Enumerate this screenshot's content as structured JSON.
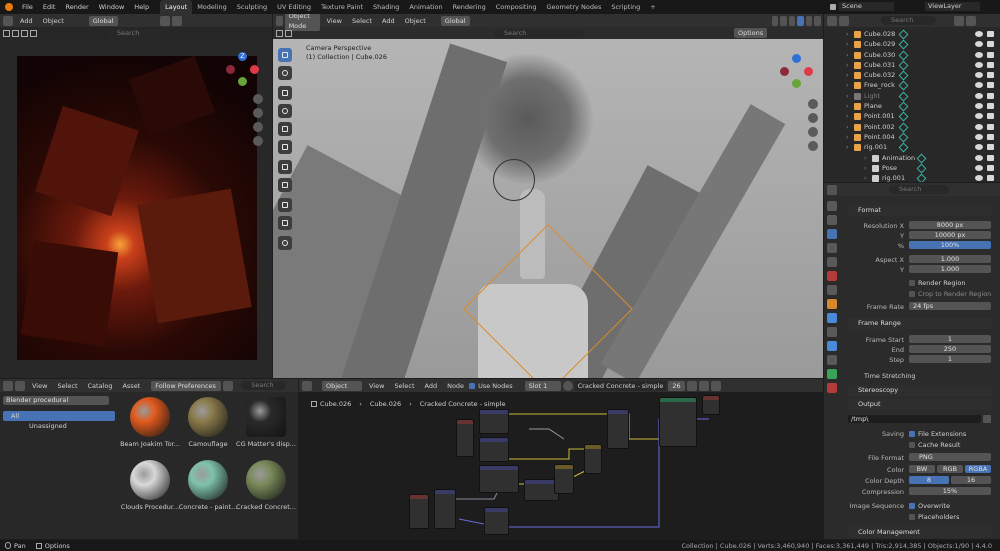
{
  "topbar": {
    "menus": [
      "File",
      "Edit",
      "Render",
      "Window",
      "Help"
    ],
    "workspaces": [
      "Layout",
      "Modeling",
      "Sculpting",
      "UV Editing",
      "Texture Paint",
      "Shading",
      "Animation",
      "Rendering",
      "Compositing",
      "Geometry Nodes",
      "Scripting"
    ],
    "active_workspace": "Layout",
    "add_tab": "+",
    "scene": "Scene",
    "view_layer": "ViewLayer"
  },
  "image_editor": {
    "menus": [
      "Add",
      "Object"
    ],
    "transform": "Global",
    "search_placeholder": "Search"
  },
  "viewport": {
    "mode": "Object Mode",
    "menus": [
      "View",
      "Select",
      "Add",
      "Object"
    ],
    "transform": "Global",
    "search_placeholder": "Search",
    "options": "Options",
    "camera_info": "Camera Perspective",
    "collection_info": "(1) Collection | Cube.026",
    "gizmo_axes": [
      "Z",
      "Y",
      "X"
    ]
  },
  "outliner": {
    "search_placeholder": "Search",
    "items": [
      {
        "label": "Cube.028",
        "color": "#e8a24a"
      },
      {
        "label": "Cube.029",
        "color": "#e8a24a"
      },
      {
        "label": "Cube.030",
        "color": "#e8a24a"
      },
      {
        "label": "Cube.031",
        "color": "#e8a24a"
      },
      {
        "label": "Cube.032",
        "color": "#e8a24a"
      },
      {
        "label": "Free_rock",
        "color": "#e8a24a"
      },
      {
        "label": "Light",
        "color": "#777777"
      },
      {
        "label": "Plane",
        "color": "#e8a24a"
      },
      {
        "label": "Point.001",
        "color": "#e8a24a"
      },
      {
        "label": "Point.002",
        "color": "#e8a24a"
      },
      {
        "label": "Point.004",
        "color": "#e8a24a"
      },
      {
        "label": "rig.001",
        "color": "#e8a24a"
      },
      {
        "label": "Animation",
        "color": "#cfcfcf"
      },
      {
        "label": "Pose",
        "color": "#cfcfcf"
      },
      {
        "label": "rig.001",
        "color": "#cfcfcf"
      }
    ]
  },
  "properties": {
    "search_placeholder": "Search",
    "format": {
      "header": "Format",
      "res_x_label": "Resolution X",
      "res_x": "8000 px",
      "res_y_label": "Y",
      "res_y": "10000 px",
      "pct_label": "%",
      "pct": "100%",
      "aspect_x_label": "Aspect X",
      "aspect_x": "1.000",
      "aspect_y_label": "Y",
      "aspect_y": "1.000",
      "render_region": "Render Region",
      "crop": "Crop to Render Region",
      "frame_rate_label": "Frame Rate",
      "frame_rate": "24 fps"
    },
    "frame_range": {
      "header": "Frame Range",
      "start_label": "Frame Start",
      "start": "1",
      "end_label": "End",
      "end": "250",
      "step_label": "Step",
      "step": "1",
      "time_stretching": "Time Stretching"
    },
    "stereoscopy": "Stereoscopy",
    "output": {
      "header": "Output",
      "path": "/tmp\\",
      "saving_label": "Saving",
      "file_ext": "File Extensions",
      "cache_result": "Cache Result",
      "file_format_label": "File Format",
      "file_format": "PNG",
      "color_label": "Color",
      "color_opts": [
        "BW",
        "RGB",
        "RGBA"
      ],
      "depth_label": "Color Depth",
      "depth_opts": [
        "8",
        "16"
      ],
      "compression_label": "Compression",
      "compression": "15%",
      "seq_label": "Image Sequence",
      "overwrite": "Overwrite",
      "placeholders": "Placeholders"
    },
    "color_management": "Color Management"
  },
  "asset_browser": {
    "menus": [
      "View",
      "Select",
      "Catalog",
      "Asset"
    ],
    "library": "Follow Preferences",
    "search_placeholder": "Search",
    "catalog_selector": "Blender procedural",
    "catalogs": [
      "All",
      "Unassigned"
    ],
    "assets": [
      {
        "label": "Beam Joakim Tor...",
        "color": "#e15a1e"
      },
      {
        "label": "Camouflage",
        "color": "#8a7a4a"
      },
      {
        "label": "CG Matter's disp...",
        "color": "#2a2a2a"
      },
      {
        "label": "Clouds Procedur...",
        "color": "#d8d8d8"
      },
      {
        "label": "Concrete - paint...",
        "color": "#7fc2aa"
      },
      {
        "label": "Cracked Concret...",
        "color": "#7a8a5a"
      }
    ]
  },
  "node_editor": {
    "object": "Object",
    "menus": [
      "View",
      "Select",
      "Add",
      "Node"
    ],
    "use_nodes": "Use Nodes",
    "slot": "Slot 1",
    "material": "Cracked Concrete - simple",
    "users": "26",
    "breadcrumb": [
      "Cube.026",
      "Cube.026",
      "Cracked Concrete - simple"
    ]
  },
  "statusbar": {
    "pan": "Pan",
    "options": "Options",
    "stats": "Collection | Cube.026 | Verts:3,460,940 | Faces:3,361,449 | Tris:2,914,385 | Objects:1/90 | 4.4.0"
  }
}
